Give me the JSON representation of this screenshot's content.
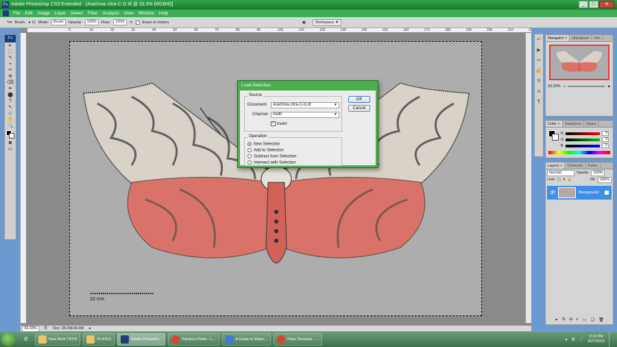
{
  "window": {
    "title": "Adobe Photoshop CS3 Extended - [Arachnia citra-C-D.tif @ 33.3% (RGB/8)]",
    "app_icon_text": "Ps",
    "controls": [
      "_",
      "□",
      "✕"
    ]
  },
  "menu": [
    "File",
    "Edit",
    "Image",
    "Layer",
    "Select",
    "Filter",
    "Analysis",
    "View",
    "Window",
    "Help"
  ],
  "options_bar": {
    "brush_label": "Brush:",
    "brush_size": "11",
    "mode_label": "Mode:",
    "mode_value": "Brush",
    "opacity_label": "Opacity:",
    "opacity_value": "100%",
    "flow_label": "Flow:",
    "flow_value": "100%",
    "erase_history_label": "Erase to History",
    "workspace_label": "Workspace ▼"
  },
  "ruler": {
    "ticks": [
      "0",
      "10",
      "20",
      "30",
      "40",
      "50",
      "60",
      "70",
      "80",
      "90",
      "100",
      "110",
      "120",
      "130",
      "140",
      "150",
      "160",
      "170",
      "180",
      "190",
      "200",
      "210",
      "220"
    ]
  },
  "toolbox": {
    "logo": "Ps",
    "tools": [
      "▸",
      "⬚",
      "✎",
      "⌖",
      "✂",
      "⊕",
      "⌫",
      "✒",
      "⬤",
      "T",
      "↖",
      "◇",
      "✋",
      "🔍"
    ]
  },
  "canvas": {
    "scalebar_label": "10 mm"
  },
  "statusbar": {
    "zoom": "33.33%",
    "doc": "Doc: 28.2M/34.0M"
  },
  "panels": {
    "navigator": {
      "tabs": [
        "Navigator ×",
        "Histogram",
        "Info"
      ],
      "zoom": "33.33%"
    },
    "color": {
      "tabs": [
        "Color ×",
        "Swatches",
        "Styles"
      ],
      "channels": [
        {
          "label": "R",
          "value": "0",
          "gradient": "#ff0000"
        },
        {
          "label": "G",
          "value": "0",
          "gradient": "#00c000"
        },
        {
          "label": "B",
          "value": "0",
          "gradient": "#0000ff"
        }
      ]
    },
    "layers": {
      "tabs": [
        "Layers ×",
        "Channels",
        "Paths"
      ],
      "blend": "Normal",
      "opacity_label": "Opacity:",
      "opacity_value": "100%",
      "lock_label": "Lock:",
      "fill_label": "Fill:",
      "fill_value": "100%",
      "layer_name": "Background"
    }
  },
  "dialog": {
    "title": "Load Selection",
    "source_legend": "Source",
    "document_label": "Document:",
    "document_value": "Arachnia citra-C-D.tif",
    "channel_label": "Channel:",
    "channel_value": "moth",
    "invert_label": "Invert",
    "invert_checked": true,
    "operation_legend": "Operation",
    "operations": [
      {
        "label": "New Selection",
        "selected": true
      },
      {
        "label": "Add to Selection",
        "selected": false
      },
      {
        "label": "Subtract from Selection",
        "selected": false
      },
      {
        "label": "Intersect with Selection",
        "selected": false
      }
    ],
    "ok_label": "OK",
    "cancel_label": "Cancel"
  },
  "taskbar": {
    "tasks": [
      {
        "label": "New Muth TIFFS",
        "icon_color": "#e8c76a",
        "active": false
      },
      {
        "label": "PLATES",
        "icon_color": "#e8c76a",
        "active": false
      },
      {
        "label": "Adobe Photosho...",
        "icon_color": "#1b3e7a",
        "active": true
      },
      {
        "label": "Pandora Radio - L...",
        "icon_color": "#d9462c",
        "active": false
      },
      {
        "label": "A Guide to Makin...",
        "icon_color": "#3b7dd8",
        "active": false
      },
      {
        "label": "Plate Template - ...",
        "icon_color": "#d9462c",
        "active": false
      }
    ],
    "time": "9:19 PM",
    "date": "6/27/2012"
  },
  "colors": {
    "accent_green": "#3fae58",
    "selection_blue": "#3e8ee8"
  }
}
